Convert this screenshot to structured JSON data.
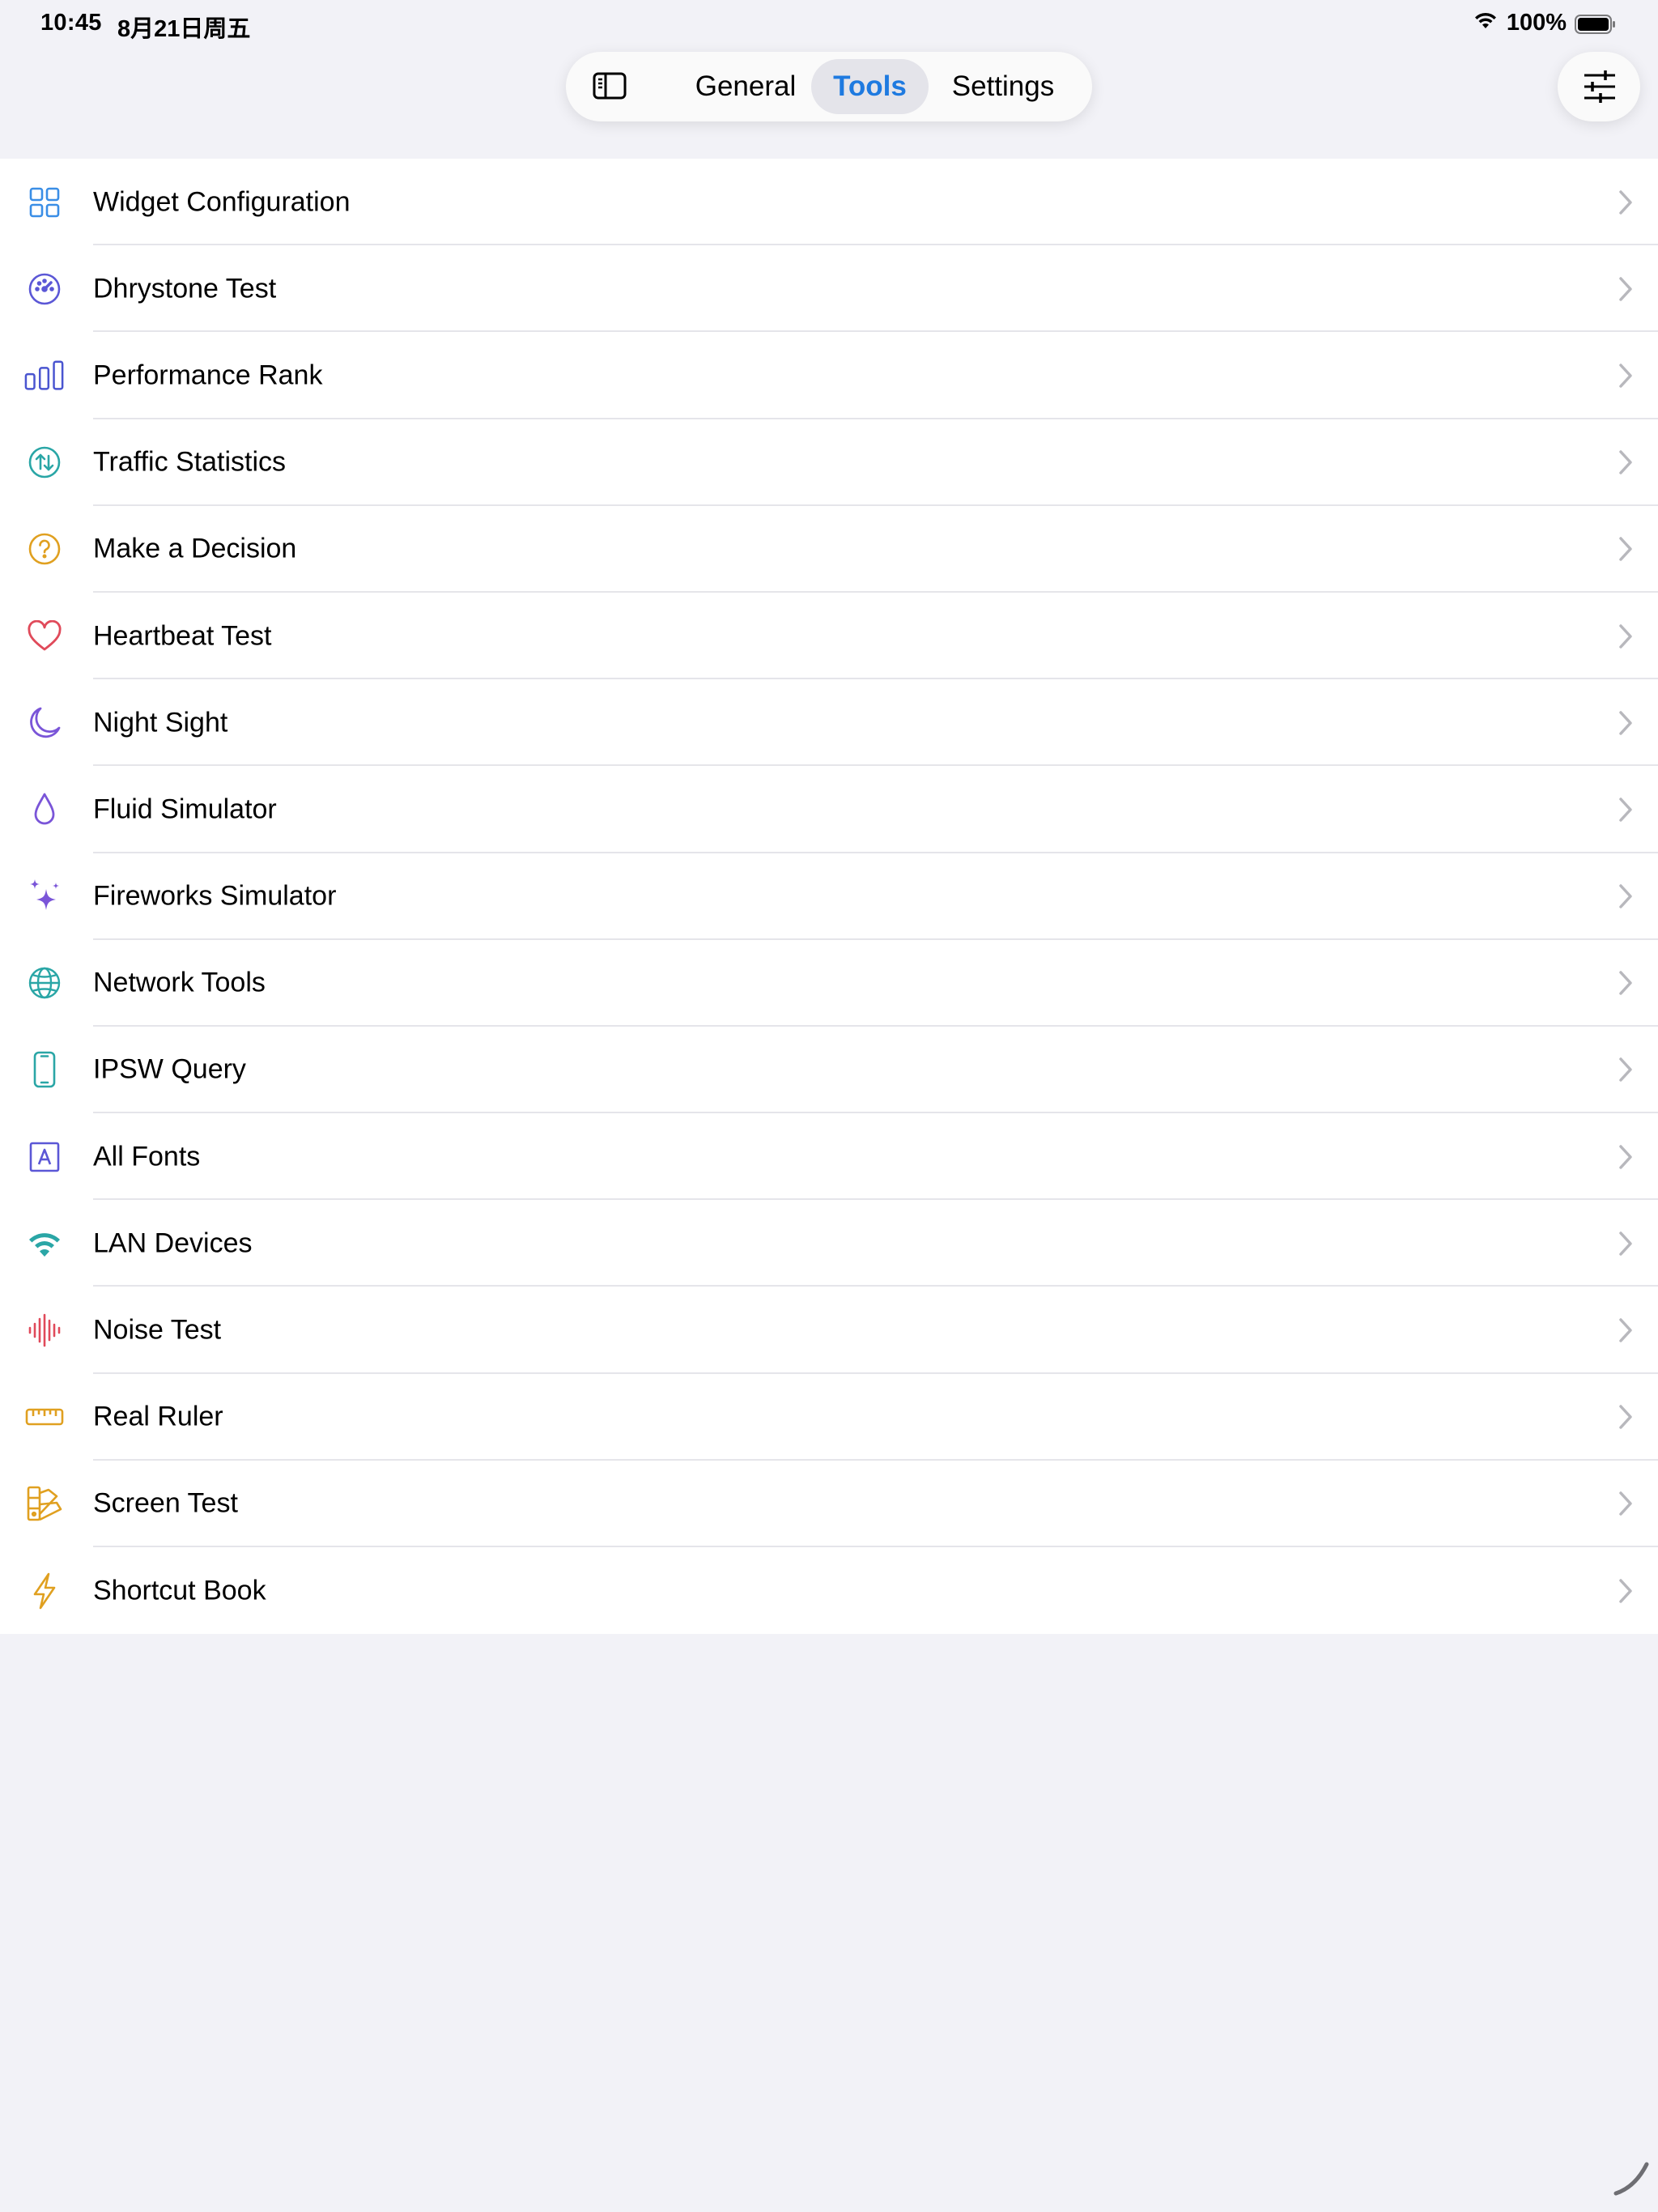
{
  "status_bar": {
    "time": "10:45",
    "date": "8月21日周五",
    "battery_percent": "100%"
  },
  "segmented": {
    "tabs": [
      {
        "label": "General"
      },
      {
        "label": "Tools"
      },
      {
        "label": "Settings"
      }
    ],
    "active": "Tools"
  },
  "colors": {
    "accent": "#1e7ae0",
    "background": "#f2f2f7",
    "list_background": "#ffffff",
    "separator": "#e5e5ea"
  },
  "tools": [
    {
      "label": "Widget Configuration",
      "icon": "grid-icon",
      "color": "#3a8ee6"
    },
    {
      "label": "Dhrystone Test",
      "icon": "speedometer-icon",
      "color": "#5b57d6"
    },
    {
      "label": "Performance Rank",
      "icon": "bar-chart-icon",
      "color": "#4a55d0"
    },
    {
      "label": "Traffic Statistics",
      "icon": "arrows-up-down-icon",
      "color": "#2aa6a6"
    },
    {
      "label": "Make a Decision",
      "icon": "question-icon",
      "color": "#e0a020"
    },
    {
      "label": "Heartbeat Test",
      "icon": "heart-icon",
      "color": "#e04a5a"
    },
    {
      "label": "Night Sight",
      "icon": "moon-icon",
      "color": "#7a55d8"
    },
    {
      "label": "Fluid Simulator",
      "icon": "drop-icon",
      "color": "#7a55d8"
    },
    {
      "label": "Fireworks Simulator",
      "icon": "sparkles-icon",
      "color": "#7a55d8"
    },
    {
      "label": "Network Tools",
      "icon": "globe-icon",
      "color": "#2aa6a6"
    },
    {
      "label": "IPSW Query",
      "icon": "phone-icon",
      "color": "#2aa6a6"
    },
    {
      "label": "All Fonts",
      "icon": "font-icon",
      "color": "#5b57d6"
    },
    {
      "label": "LAN Devices",
      "icon": "wifi-icon",
      "color": "#2aa6a6"
    },
    {
      "label": "Noise Test",
      "icon": "waveform-icon",
      "color": "#e04a5a"
    },
    {
      "label": "Real Ruler",
      "icon": "ruler-icon",
      "color": "#e0a020"
    },
    {
      "label": "Screen Test",
      "icon": "swatch-icon",
      "color": "#e0a020"
    },
    {
      "label": "Shortcut Book",
      "icon": "bolt-icon",
      "color": "#e0a020"
    }
  ]
}
